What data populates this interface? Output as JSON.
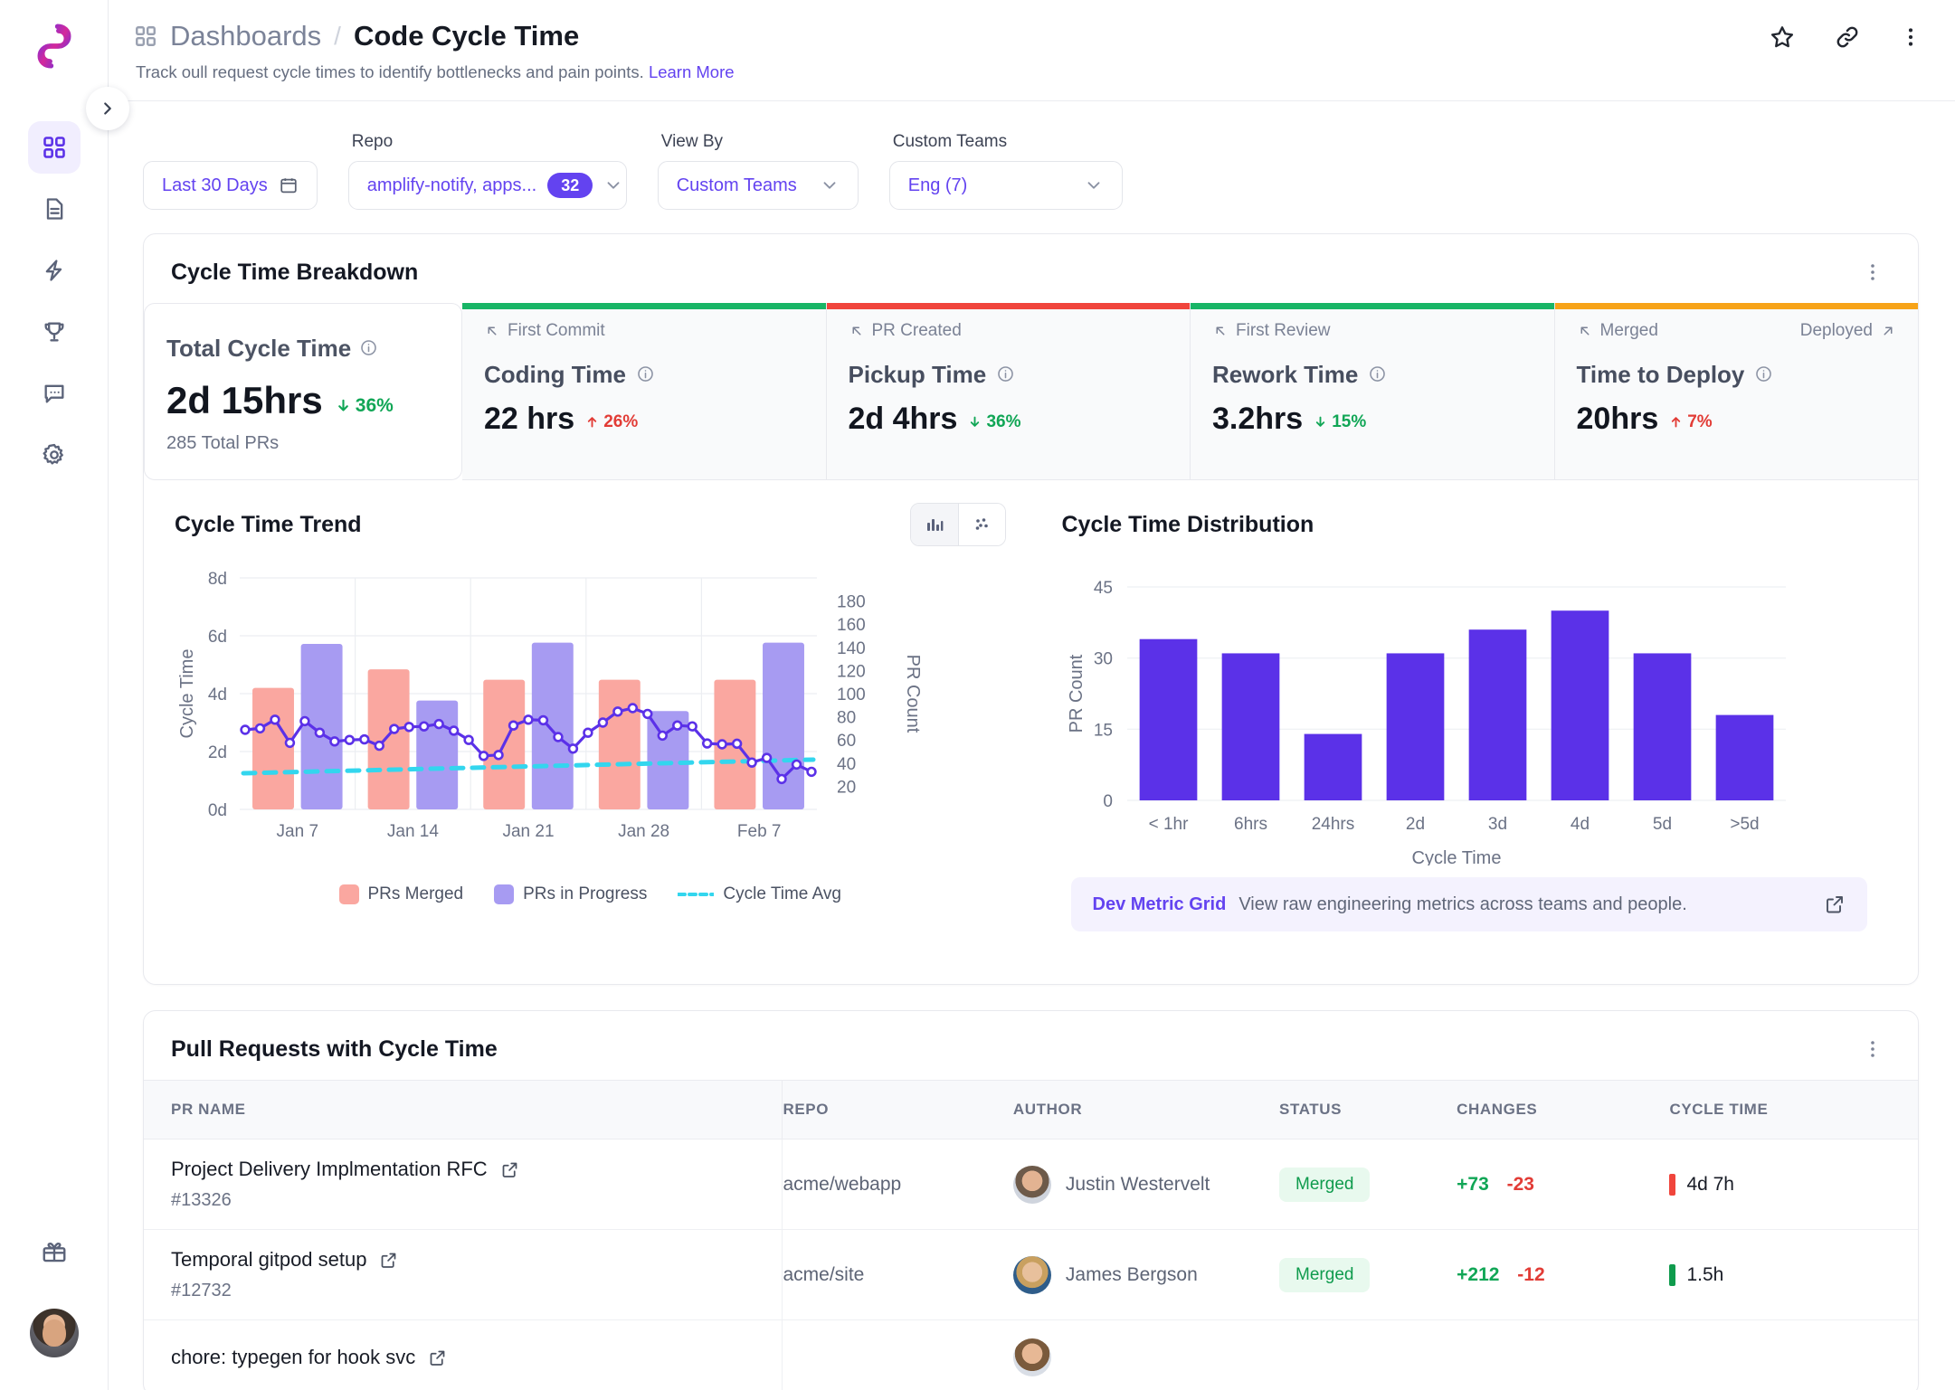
{
  "sidebar": {
    "logo_name": "app-logo",
    "items": [
      {
        "name": "dashboards",
        "icon": "grid-icon",
        "active": true
      },
      {
        "name": "documents",
        "icon": "document-icon",
        "active": false
      },
      {
        "name": "insights",
        "icon": "lightning-icon",
        "active": false
      },
      {
        "name": "goals",
        "icon": "trophy-icon",
        "active": false
      },
      {
        "name": "feedback",
        "icon": "chat-icon",
        "active": false
      },
      {
        "name": "settings",
        "icon": "gear-icon",
        "active": false
      }
    ],
    "bottom": [
      {
        "name": "whats-new",
        "icon": "gift-icon"
      }
    ]
  },
  "header": {
    "breadcrumb_root": "Dashboards",
    "breadcrumb_sep": "/",
    "title": "Code Cycle Time",
    "subtitle": "Track oull request cycle times to identify bottlenecks and pain points.",
    "learn_more": "Learn More",
    "actions": [
      "star-icon",
      "link-icon",
      "more-vertical-icon"
    ]
  },
  "filters": {
    "date": {
      "label": "",
      "value": "Last 30 Days"
    },
    "repo": {
      "label": "Repo",
      "value": "amplify-notify, apps...",
      "count": "32"
    },
    "view_by": {
      "label": "View By",
      "value": "Custom Teams"
    },
    "custom_teams": {
      "label": "Custom Teams",
      "value": "Eng (7)"
    }
  },
  "breakdown": {
    "card_title": "Cycle Time Breakdown",
    "total": {
      "label": "Total Cycle Time",
      "value": "2d 15hrs",
      "delta": "36%",
      "delta_dir": "down",
      "sub": "285 Total PRs"
    },
    "stages": [
      {
        "start_event": "First Commit",
        "end_event": "",
        "name": "Coding Time",
        "value": "22 hrs",
        "delta": "26%",
        "delta_dir": "up",
        "color": "#18b566"
      },
      {
        "start_event": "PR Created",
        "end_event": "",
        "name": "Pickup Time",
        "value": "2d 4hrs",
        "delta": "36%",
        "delta_dir": "down",
        "color": "#f0453c"
      },
      {
        "start_event": "First Review",
        "end_event": "",
        "name": "Rework Time",
        "value": "3.2hrs",
        "delta": "15%",
        "delta_dir": "down",
        "color": "#18b566"
      },
      {
        "start_event": "Merged",
        "end_event": "Deployed",
        "name": "Time to Deploy",
        "value": "20hrs",
        "delta": "7%",
        "delta_dir": "up",
        "color": "#f7a318"
      }
    ]
  },
  "chart_data": [
    {
      "type": "bar",
      "title": "Cycle Time Trend",
      "xlabel": "",
      "ylabel": "Cycle Time",
      "y2label": "PR Count",
      "ylim": [
        0,
        8
      ],
      "yticks": [
        "0d",
        "2d",
        "4d",
        "6d",
        "8d"
      ],
      "y2lim": [
        0,
        200
      ],
      "y2ticks": [
        "20",
        "40",
        "60",
        "80",
        "100",
        "120",
        "140",
        "160",
        "180"
      ],
      "xticks": [
        "Jan 7",
        "Jan 14",
        "Jan 21",
        "Jan 28",
        "Feb 7"
      ],
      "grid": true,
      "legend": [
        {
          "label": "PRs Merged",
          "color": "#faa7a0",
          "style": "bar"
        },
        {
          "label": "PRs in Progress",
          "color": "#a79bf2",
          "style": "bar"
        },
        {
          "label": "Cycle Time Avg",
          "color": "#33d6ee",
          "style": "dashed-line"
        }
      ],
      "bars": [
        {
          "series": "PRs Merged",
          "value": 105
        },
        {
          "series": "PRs in Progress",
          "value": 143
        },
        {
          "series": "PRs Merged",
          "value": 121
        },
        {
          "series": "PRs in Progress",
          "value": 94
        },
        {
          "series": "PRs Merged",
          "value": 112
        },
        {
          "series": "PRs in Progress",
          "value": 144
        },
        {
          "series": "PRs Merged",
          "value": 112
        },
        {
          "series": "PRs in Progress",
          "value": 85
        },
        {
          "series": "PRs Merged",
          "value": 112
        },
        {
          "series": "PRs in Progress",
          "value": 144
        }
      ],
      "line_series": {
        "name": "Cycle Time",
        "color": "#5b31e8",
        "values": [
          2.75,
          2.8,
          3.1,
          2.3,
          3.05,
          2.65,
          2.35,
          2.4,
          2.42,
          2.2,
          2.78,
          2.85,
          2.87,
          2.95,
          2.72,
          2.4,
          1.85,
          1.88,
          2.9,
          3.1,
          3.08,
          2.5,
          2.1,
          2.65,
          3.0,
          3.38,
          3.5,
          3.3,
          2.55,
          2.9,
          2.87,
          2.28,
          2.25,
          2.27,
          1.62,
          1.78,
          1.05,
          1.55,
          1.3
        ]
      },
      "avg_line": {
        "name": "Cycle Time Avg",
        "color": "#33d6ee",
        "start": 1.25,
        "end": 1.72
      }
    },
    {
      "type": "bar",
      "title": "Cycle Time Distribution",
      "xlabel": "Cycle Time",
      "ylabel": "PR Count",
      "ylim": [
        0,
        45
      ],
      "yticks": [
        "0",
        "15",
        "30",
        "45"
      ],
      "categories": [
        "< 1hr",
        "6hrs",
        "24hrs",
        "2d",
        "3d",
        "4d",
        "5d",
        ">5d"
      ],
      "values": [
        34,
        31,
        14,
        31,
        36,
        40,
        31,
        18
      ],
      "color": "#5b31e8",
      "grid": true
    }
  ],
  "chart_toggle": {
    "bar_icon": "bar-chart-icon",
    "scatter_icon": "scatter-plot-icon",
    "active": "bar"
  },
  "metric_banner": {
    "link": "Dev Metric Grid",
    "text": "View raw engineering metrics across teams and people.",
    "icon": "external-link-icon"
  },
  "table": {
    "title": "Pull Requests with Cycle Time",
    "columns": [
      "PR NAME",
      "REPO",
      "AUTHOR",
      "STATUS",
      "CHANGES",
      "CYCLE TIME"
    ],
    "rows": [
      {
        "pr_name": "Project Delivery Implmentation RFC",
        "pr_number": "#13326",
        "repo": "acme/webapp",
        "author": "Justin Westervelt",
        "avatar": "av-1",
        "status": "Merged",
        "added": "+73",
        "removed": "-23",
        "cycle_time": "4d 7h",
        "cycle_color": "#f0453c"
      },
      {
        "pr_name": "Temporal gitpod setup",
        "pr_number": "#12732",
        "repo": "acme/site",
        "author": "James Bergson",
        "avatar": "av-2",
        "status": "Merged",
        "added": "+212",
        "removed": "-12",
        "cycle_time": "1.5h",
        "cycle_color": "#0f9b4d"
      },
      {
        "pr_name": "chore: typegen for hook svc",
        "pr_number": "",
        "repo": "",
        "author": "",
        "avatar": "av-3",
        "status": "",
        "added": "",
        "removed": "",
        "cycle_time": "",
        "cycle_color": "#a79bf2"
      }
    ]
  }
}
